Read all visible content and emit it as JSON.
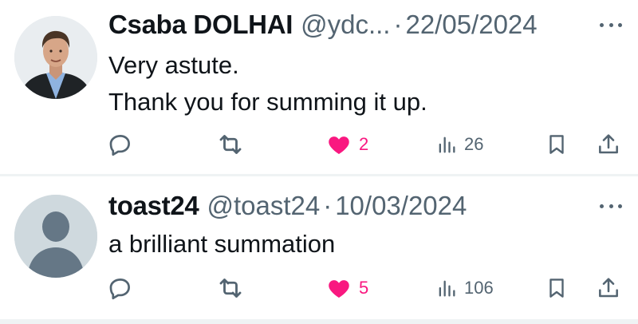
{
  "posts": [
    {
      "author_name": "Csaba DOLHAI",
      "handle": "@ydc...",
      "separator": "·",
      "date": "22/05/2024",
      "lines": [
        "Very astute.",
        "Thank you for summing it up."
      ],
      "likes": "2",
      "views": "26",
      "liked": true,
      "avatar": "profile-photo"
    },
    {
      "author_name": "toast24",
      "handle": "@toast24",
      "separator": "·",
      "date": "10/03/2024",
      "lines": [
        "a brilliant summation"
      ],
      "likes": "5",
      "views": "106",
      "liked": true,
      "avatar": "default-avatar"
    }
  ],
  "icons": {
    "reply": "reply-icon",
    "retweet": "retweet-icon",
    "like": "heart-filled-icon",
    "views": "views-icon",
    "bookmark": "bookmark-icon",
    "share": "share-icon",
    "more": "more-options-icon"
  },
  "colors": {
    "text": "#0f1419",
    "secondary": "#536471",
    "like": "#f91880",
    "divider": "#eff3f4",
    "default_avatar_bg": "#cfd9de",
    "default_avatar_fg": "#657786"
  }
}
